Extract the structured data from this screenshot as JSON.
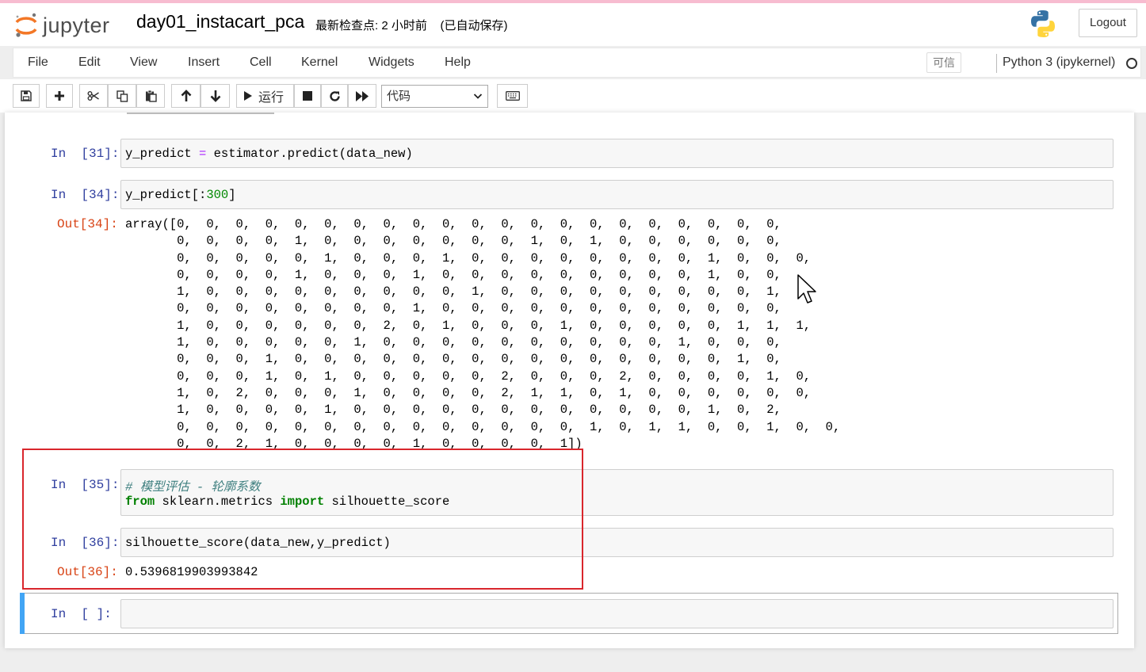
{
  "header": {
    "logo_text": "jupyter",
    "notebook_name": "day01_instacart_pca",
    "checkpoint": "最新检查点: 2 小时前    (已自动保存)",
    "logout_label": "Logout"
  },
  "menu": {
    "items": [
      "File",
      "Edit",
      "View",
      "Insert",
      "Cell",
      "Kernel",
      "Widgets",
      "Help"
    ],
    "trusted_label": "可信",
    "kernel_name": "Python 3 (ipykernel)"
  },
  "toolbar": {
    "run_label": "运行",
    "cell_type": "代码"
  },
  "cells": [
    {
      "in_prompt": "In  [31]:",
      "code_parts": [
        "y_predict ",
        "=",
        " estimator.predict(data_new)"
      ]
    },
    {
      "in_prompt": "In  [34]:",
      "code_parts": [
        "y_predict[:",
        "300",
        "]"
      ],
      "out_prompt": "Out[34]:",
      "output_lines": [
        "array([0,  0,  0,  0,  0,  0,  0,  0,  0,  0,  0,  0,  0,  0,  0,  0,  0,  0,  0,  0,  0,",
        "       0,  0,  0,  0,  1,  0,  0,  0,  0,  0,  0,  0,  1,  0,  1,  0,  0,  0,  0,  0,  0,",
        "       0,  0,  0,  0,  0,  1,  0,  0,  0,  1,  0,  0,  0,  0,  0,  0,  0,  0,  1,  0,  0,  0,",
        "       0,  0,  0,  0,  1,  0,  0,  0,  1,  0,  0,  0,  0,  0,  0,  0,  0,  0,  1,  0,  0,",
        "       1,  0,  0,  0,  0,  0,  0,  0,  0,  0,  1,  0,  0,  0,  0,  0,  0,  0,  0,  0,  1,",
        "       0,  0,  0,  0,  0,  0,  0,  0,  1,  0,  0,  0,  0,  0,  0,  0,  0,  0,  0,  0,  0,",
        "       1,  0,  0,  0,  0,  0,  0,  2,  0,  1,  0,  0,  0,  1,  0,  0,  0,  0,  0,  1,  1,  1,",
        "       1,  0,  0,  0,  0,  0,  1,  0,  0,  0,  0,  0,  0,  0,  0,  0,  0,  1,  0,  0,  0,",
        "       0,  0,  0,  1,  0,  0,  0,  0,  0,  0,  0,  0,  0,  0,  0,  0,  0,  0,  0,  1,  0,",
        "       0,  0,  0,  1,  0,  1,  0,  0,  0,  0,  0,  2,  0,  0,  0,  2,  0,  0,  0,  0,  1,  0,",
        "       1,  0,  2,  0,  0,  0,  1,  0,  0,  0,  0,  2,  1,  1,  0,  1,  0,  0,  0,  0,  0,  0,",
        "       1,  0,  0,  0,  0,  1,  0,  0,  0,  0,  0,  0,  0,  0,  0,  0,  0,  0,  1,  0,  2,",
        "       0,  0,  0,  0,  0,  0,  0,  0,  0,  0,  0,  0,  0,  0,  1,  0,  1,  1,  0,  0,  1,  0,  0,",
        "       0,  0,  2,  1,  0,  0,  0,  0,  1,  0,  0,  0,  0,  1])"
      ]
    },
    {
      "in_prompt": "In  [35]:",
      "comment": "# 模型评估 - 轮廓系数",
      "code_parts": [
        "from",
        " sklearn.metrics ",
        "import",
        " silhouette_score"
      ]
    },
    {
      "in_prompt": "In  [36]:",
      "code_parts": [
        "silhouette_score(data_new,y_predict)"
      ],
      "out_prompt": "Out[36]:",
      "output_lines": [
        "0.5396819903993842"
      ]
    },
    {
      "in_prompt": "In  [ ]:"
    }
  ]
}
